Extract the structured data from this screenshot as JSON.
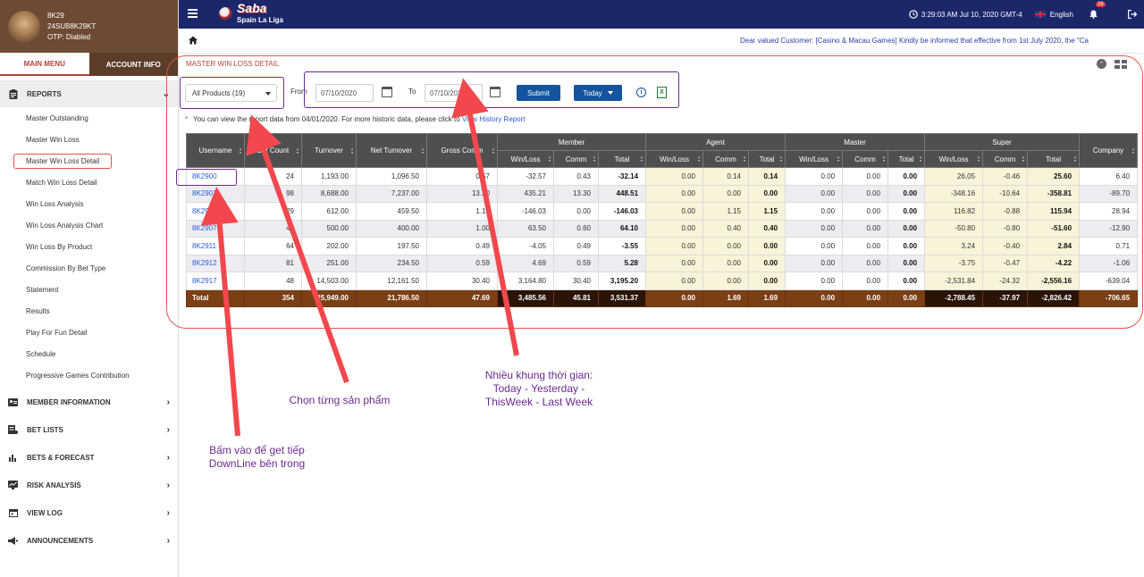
{
  "user": {
    "name": "8K29",
    "code": "24SUB8K29KT",
    "otp": "OTP: Diabled"
  },
  "sidebar": {
    "tabs": [
      "MAIN MENU",
      "ACCOUNT INFO"
    ],
    "reports_label": "REPORTS",
    "report_items": [
      "Master Outstanding",
      "Master Win Loss",
      "Master Win Loss Detail",
      "Match Win Loss Detail",
      "Win Loss Analysis",
      "Win Loss Analysis Chart",
      "Win Loss By Product",
      "Commission By Bet Type",
      "Statement",
      "Results",
      "Play For Fun Detail",
      "Schedule",
      "Progressive Games Contribution"
    ],
    "sections": [
      "MEMBER INFORMATION",
      "BET LISTS",
      "BETS & FORECAST",
      "RISK ANALYSIS",
      "VIEW LOG",
      "ANNOUNCEMENTS"
    ]
  },
  "topbar": {
    "logo_main": "Saba",
    "logo_sub": "Spain La Liga",
    "datetime": "3:29:03 AM Jul 10, 2020 GMT-4",
    "language": "English",
    "notifications": "28"
  },
  "marquee": "Dear valued Customer: [Casino & Macau Games] Kindly be informed that effective from 1st July 2020, the \"Ca",
  "page_title": "MASTER WIN LOSS DETAIL",
  "filters": {
    "product": "All Products (19)",
    "from_label": "From",
    "from_date": "07/10/2020",
    "to_label": "To",
    "to_date": "07/10/2020",
    "submit": "Submit",
    "period": "Today"
  },
  "note": {
    "text": "You can view the report data from 04/01/2020. For more historic data, please click to",
    "link": "View History Report"
  },
  "table": {
    "group_headers": [
      "Member",
      "Agent",
      "Master",
      "Super"
    ],
    "headers": [
      "Username",
      "Bet Count",
      "Turnover",
      "Net Turnover",
      "Gross Comm",
      "Company"
    ],
    "sub_headers": [
      "Win/Loss",
      "Comm",
      "Total"
    ],
    "rows": [
      [
        "8K2900",
        "24",
        "1,193.00",
        "1,096.50",
        "0.57",
        "-32.57",
        "0.43",
        "-32.14",
        "0.00",
        "0.14",
        "0.14",
        "0.00",
        "0.00",
        "0.00",
        "26.05",
        "-0.46",
        "25.60",
        "6.40"
      ],
      [
        "8K2903",
        "98",
        "8,688.00",
        "7,237.00",
        "13.30",
        "435.21",
        "13.30",
        "448.51",
        "0.00",
        "0.00",
        "0.00",
        "0.00",
        "0.00",
        "0.00",
        "-348.16",
        "-10.64",
        "-358.81",
        "-89.70"
      ],
      [
        "8K2906",
        "29",
        "612.00",
        "459.50",
        "1.15",
        "-146.03",
        "0.00",
        "-146.03",
        "0.00",
        "1.15",
        "1.15",
        "0.00",
        "0.00",
        "0.00",
        "116.82",
        "-0.88",
        "115.94",
        "28.94"
      ],
      [
        "8K2907",
        "40",
        "500.00",
        "400.00",
        "1.00",
        "63.50",
        "0.60",
        "64.10",
        "0.00",
        "0.40",
        "0.40",
        "0.00",
        "0.00",
        "0.00",
        "-50.80",
        "-0.80",
        "-51.60",
        "-12.90"
      ],
      [
        "8K2911",
        "64",
        "202.00",
        "197.50",
        "0.49",
        "-4.05",
        "0.49",
        "-3.55",
        "0.00",
        "0.00",
        "0.00",
        "0.00",
        "0.00",
        "0.00",
        "3.24",
        "-0.40",
        "2.84",
        "0.71"
      ],
      [
        "8K2912",
        "81",
        "251.00",
        "234.50",
        "0.59",
        "4.69",
        "0.59",
        "5.28",
        "0.00",
        "0.00",
        "0.00",
        "0.00",
        "0.00",
        "0.00",
        "-3.75",
        "-0.47",
        "-4.22",
        "-1.06"
      ],
      [
        "8K2917",
        "48",
        "14,503.00",
        "12,161.50",
        "30.40",
        "3,164.80",
        "30.40",
        "3,195.20",
        "0.00",
        "0.00",
        "0.00",
        "0.00",
        "0.00",
        "0.00",
        "-2,531.84",
        "-24.32",
        "-2,556.16",
        "-639.04"
      ]
    ],
    "total": [
      "Total",
      "354",
      "25,949.00",
      "21,786.50",
      "47.69",
      "3,485.56",
      "45.81",
      "3,531.37",
      "0.00",
      "1.69",
      "1.69",
      "0.00",
      "0.00",
      "0.00",
      "-2,788.45",
      "-37.97",
      "-2,826.42",
      "-706.65"
    ]
  },
  "annotations": {
    "product": "Chọn từng sản phẩm",
    "timeframe": [
      "Nhiều khung thời gian:",
      "Today - Yesterday -",
      "ThisWeek - Last Week"
    ],
    "downline": [
      "Bấm vào để get tiếp",
      "DownLine bên trong"
    ]
  }
}
